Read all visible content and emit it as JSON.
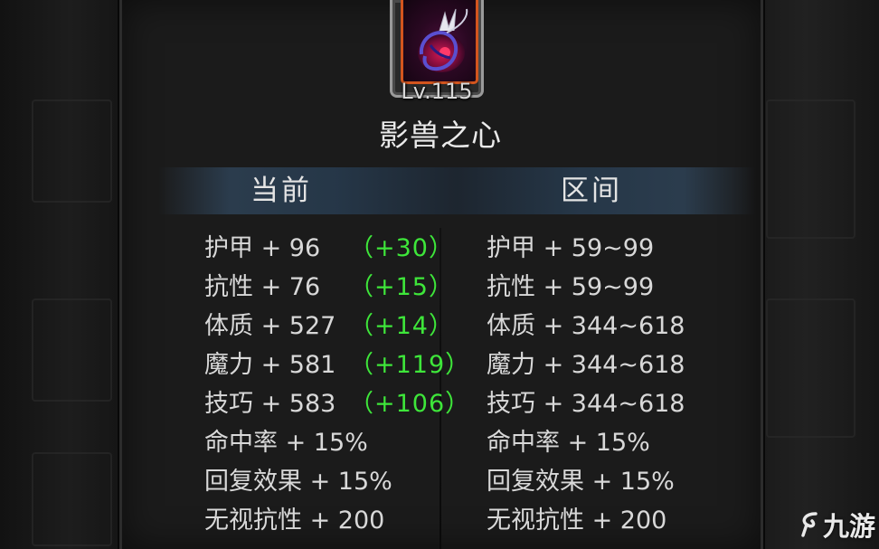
{
  "item": {
    "level": "Lv.115",
    "name": "影兽之心",
    "icon": "dark-beast-heart-icon",
    "frame_color": "#d3551e"
  },
  "headers": {
    "current": "当前",
    "range": "区间"
  },
  "current_stats": [
    {
      "label": "护甲 + 96",
      "bonus": "（+30）"
    },
    {
      "label": "抗性 + 76",
      "bonus": "（+15）"
    },
    {
      "label": "体质 + 527",
      "bonus": "（+14）"
    },
    {
      "label": "魔力 + 581",
      "bonus": "（+119）"
    },
    {
      "label": "技巧 + 583",
      "bonus": "（+106）"
    },
    {
      "label": "命中率 + 15%"
    },
    {
      "label": "回复效果 + 15%"
    },
    {
      "label": "无视抗性 + 200"
    }
  ],
  "range_stats": [
    {
      "label": "护甲 + 59~99"
    },
    {
      "label": "抗性 + 59~99"
    },
    {
      "label": "体质 + 344~618"
    },
    {
      "label": "魔力 + 344~618"
    },
    {
      "label": "技巧 + 344~618"
    },
    {
      "label": "命中率 + 15%"
    },
    {
      "label": "回复效果 + 15%"
    },
    {
      "label": "无视抗性 + 200"
    }
  ],
  "watermark": {
    "text": "九游",
    "icon": "swirl-logo-icon"
  },
  "colors": {
    "bonus_green": "#3ee63a",
    "text": "#d8d8d8",
    "panel_bg": "#1b1b1b"
  }
}
